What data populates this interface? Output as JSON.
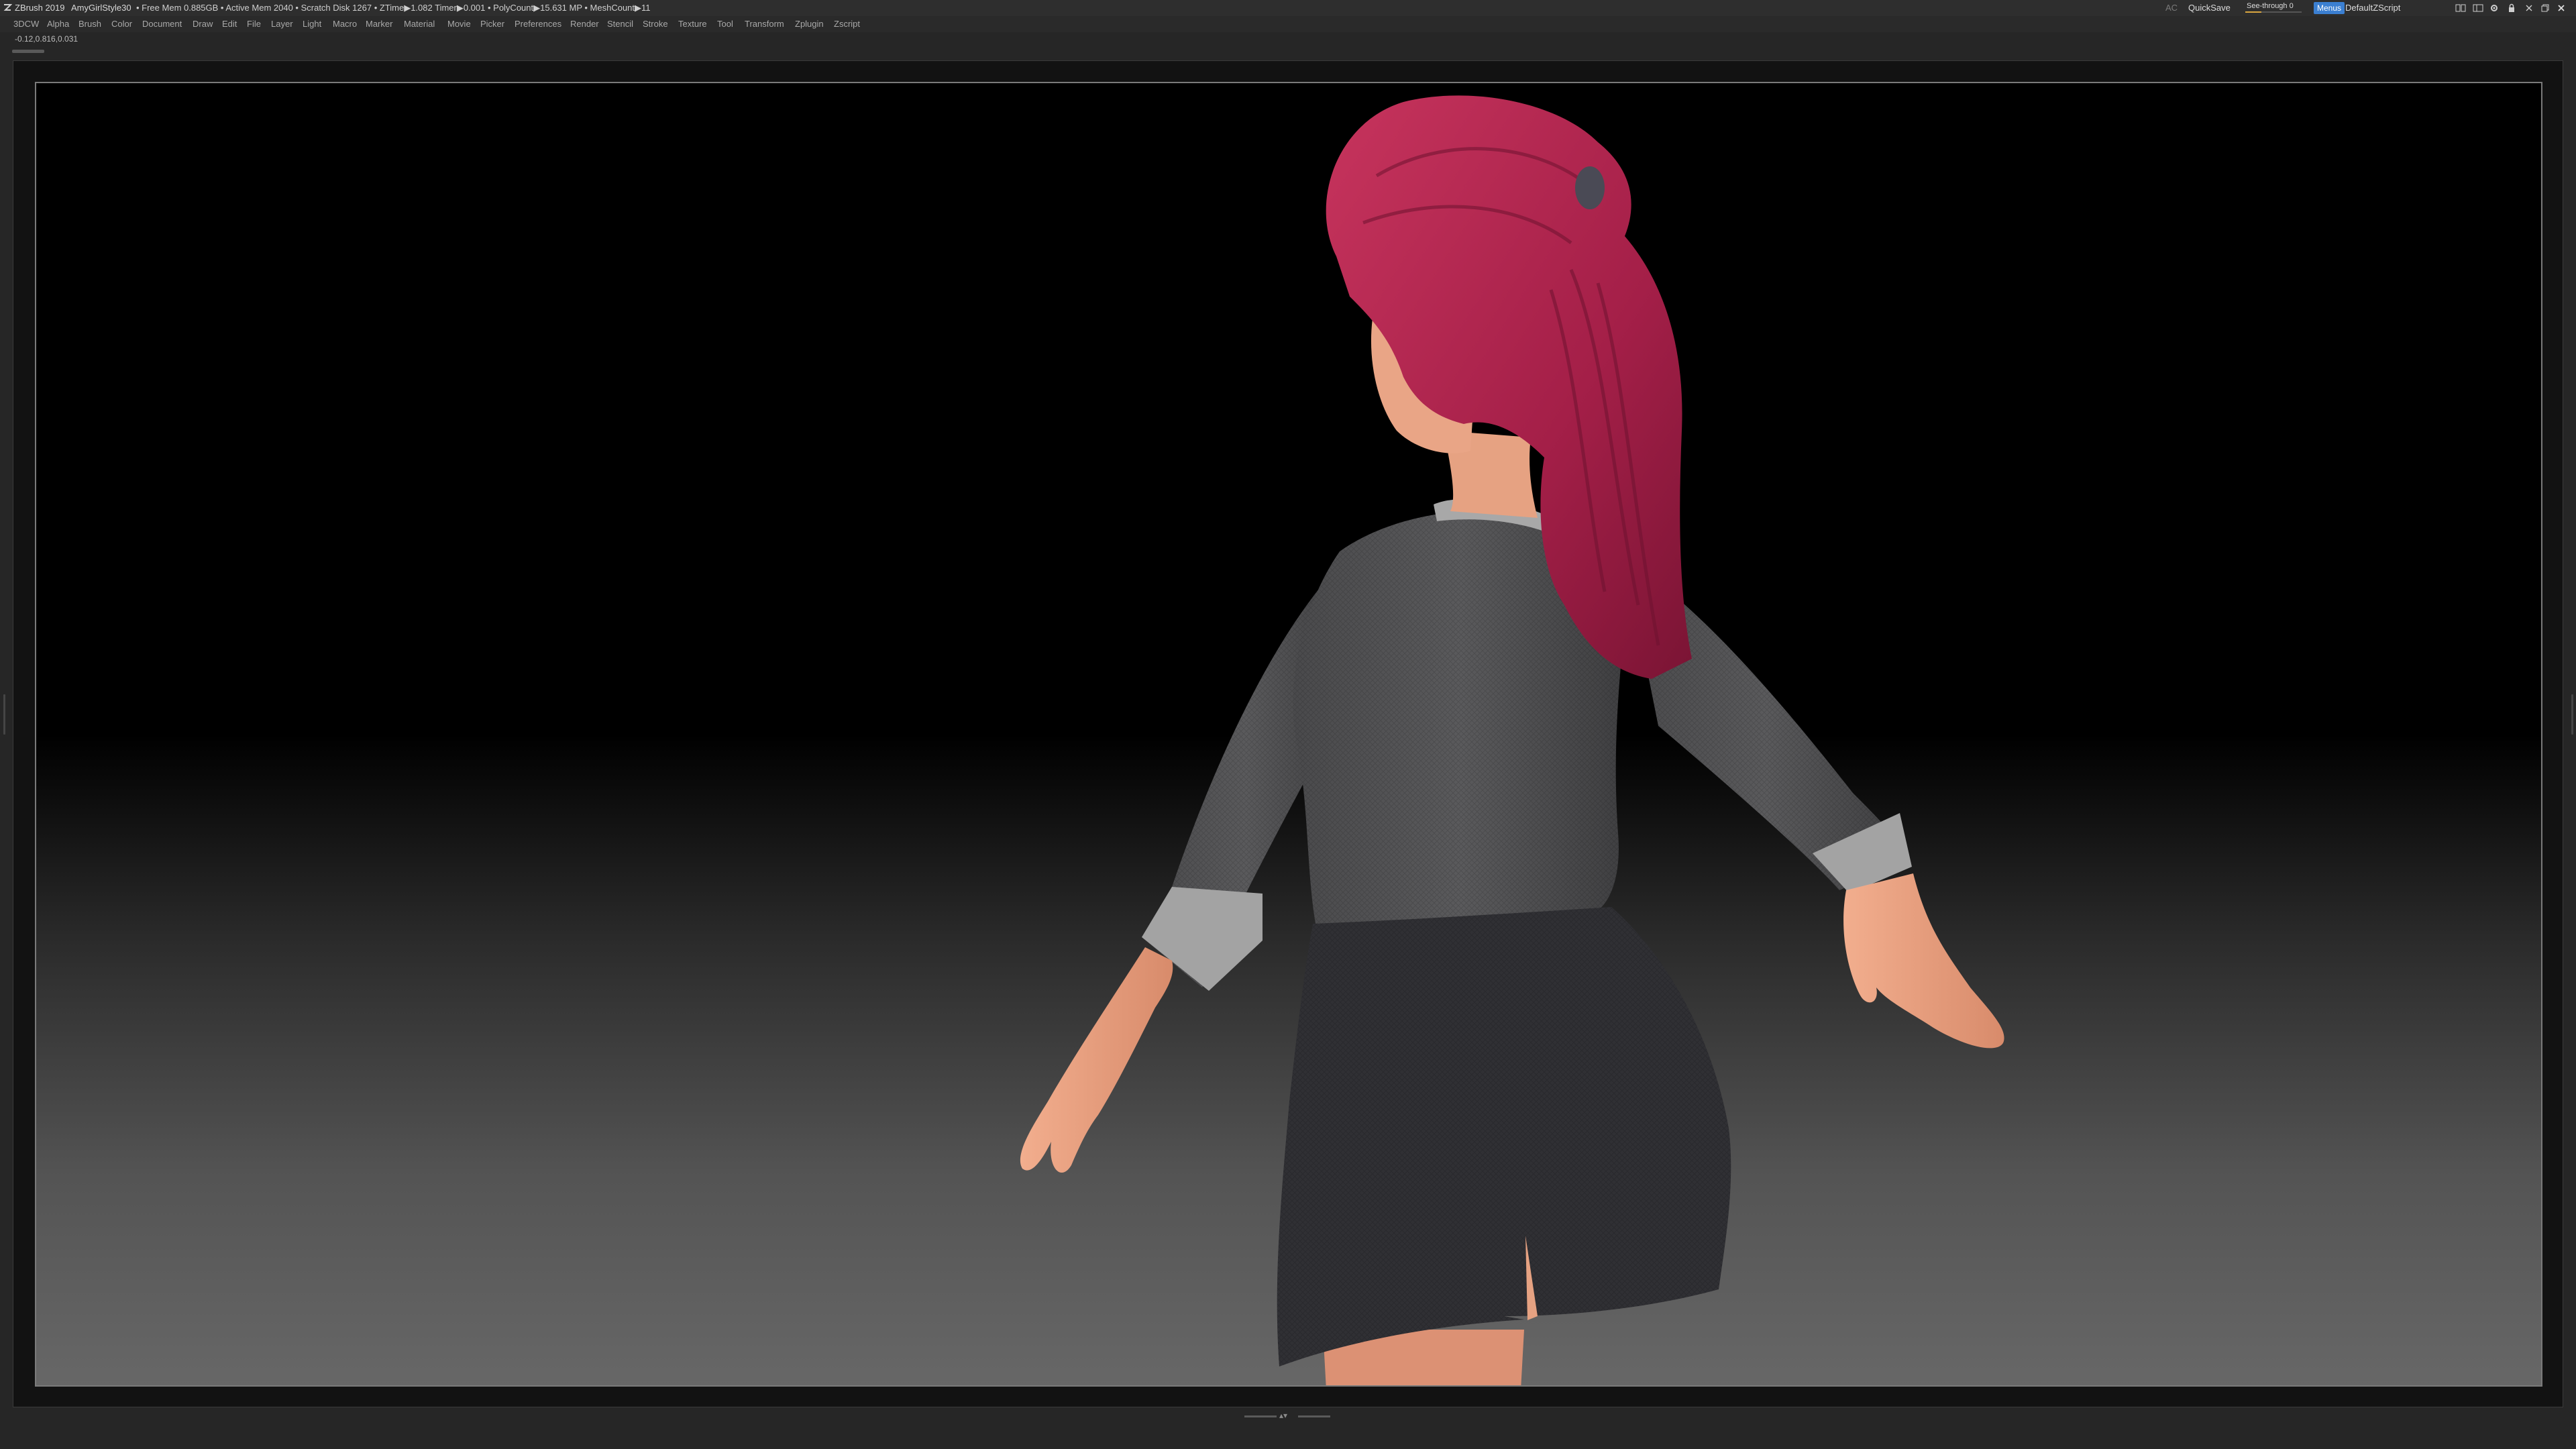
{
  "titlebar": {
    "app_title": "ZBrush 2019",
    "document_name": "AmyGirlStyle30",
    "stats": "• Free Mem 0.885GB • Active Mem 2040 • Scratch Disk 1267 • ZTime▶1.082 Timer▶0.001 • PolyCount▶15.631 MP • MeshCount▶11",
    "ac_label": "AC",
    "quicksave_label": "QuickSave",
    "see_through_label": "See-through  0",
    "see_through_value": 0,
    "menus_label": "Menus",
    "default_zscript_label": "DefaultZScript",
    "icons": [
      "layout-icon",
      "layout-icon-2",
      "settings-icon",
      "lock-icon",
      "minimize-icon",
      "restore-icon",
      "close-icon"
    ],
    "accent_color": "#3b7fd1",
    "slider_color": "#d9a640"
  },
  "menubar": {
    "items": [
      "3DCW",
      "Alpha",
      "Brush",
      "Color",
      "Document",
      "Draw",
      "Edit",
      "File",
      "Layer",
      "Light",
      "Macro",
      "Marker",
      "Material",
      "Movie",
      "Picker",
      "Preferences",
      "Render",
      "Stencil",
      "Stroke",
      "Texture",
      "Tool",
      "Transform",
      "Zplugin",
      "Zscript"
    ]
  },
  "status": {
    "coordinates": "-0.12,0.816,0.031"
  },
  "viewport": {
    "subject": "3D character model",
    "hair_color": "#b0234f",
    "jacket_color": "#545454",
    "skirt_color": "#303034",
    "skin_color": "#e8a080"
  },
  "tray": {
    "bottom_arrows": "▴▾"
  }
}
